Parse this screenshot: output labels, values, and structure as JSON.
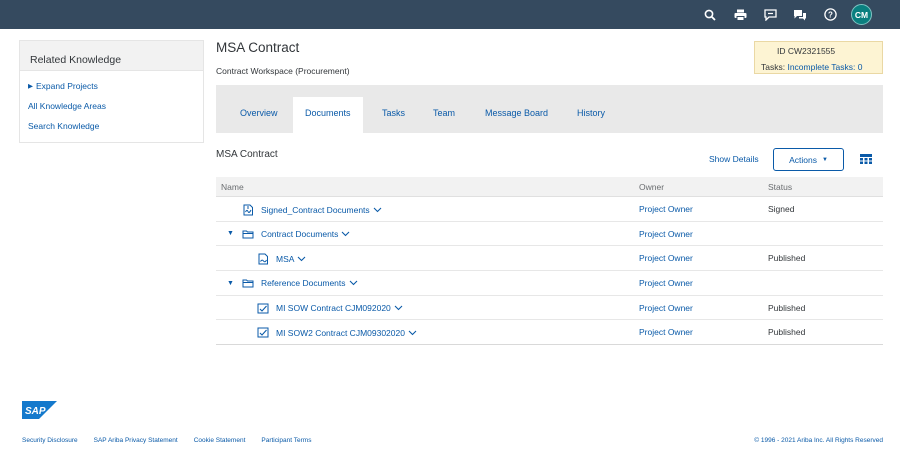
{
  "shell": {
    "icons": [
      "search-icon",
      "print-icon",
      "feedback-icon",
      "chat-icon",
      "help-icon"
    ],
    "avatar_initials": "CM",
    "bg_color": "#354a5f",
    "avatar_color": "#0a7f7f"
  },
  "related_knowledge": {
    "title": "Related Knowledge",
    "links": [
      "Expand Projects",
      "All Knowledge Areas",
      "Search Knowledge"
    ]
  },
  "header": {
    "title": "MSA Contract",
    "subtitle": "Contract Workspace (Procurement)",
    "id_label": "ID",
    "id_value": "CW2321555",
    "tasks_label": "Tasks:",
    "tasks_link": "Incomplete Tasks: 0"
  },
  "tabs": [
    "Overview",
    "Documents",
    "Tasks",
    "Team",
    "Message Board",
    "History"
  ],
  "active_tab": "Documents",
  "documents": {
    "section_title": "MSA Contract",
    "show_details": "Show Details",
    "actions_label": "Actions",
    "columns": [
      "Name",
      "Owner",
      "Status"
    ],
    "rows": [
      {
        "name": "Signed_Contract Documents",
        "owner": "Project Owner",
        "status": "Signed",
        "icon": "signed-document-icon"
      },
      {
        "name": "Contract Documents",
        "owner": "Project Owner",
        "status": "",
        "icon": "folder-icon"
      },
      {
        "name": "MSA",
        "owner": "Project Owner",
        "status": "Published",
        "icon": "contract-document-icon"
      },
      {
        "name": "Reference Documents",
        "owner": "Project Owner",
        "status": "",
        "icon": "folder-icon"
      },
      {
        "name": "MI SOW Contract CJM092020",
        "owner": "Project Owner",
        "status": "Published",
        "icon": "document-check-icon"
      },
      {
        "name": "MI SOW2 Contract CJM09302020",
        "owner": "Project Owner",
        "status": "Published",
        "icon": "document-check-icon"
      }
    ]
  },
  "footer": {
    "logo_text": "SAP",
    "links": [
      "Security Disclosure",
      "SAP Ariba Privacy Statement",
      "Cookie Statement",
      "Participant Terms"
    ],
    "copyright": "© 1996 - 2021 Ariba Inc. All Rights Reserved"
  },
  "colors": {
    "link": "#0a5aa8",
    "info_box_bg": "#fdf4d3",
    "tabbar_bg": "#e9e9e9"
  }
}
